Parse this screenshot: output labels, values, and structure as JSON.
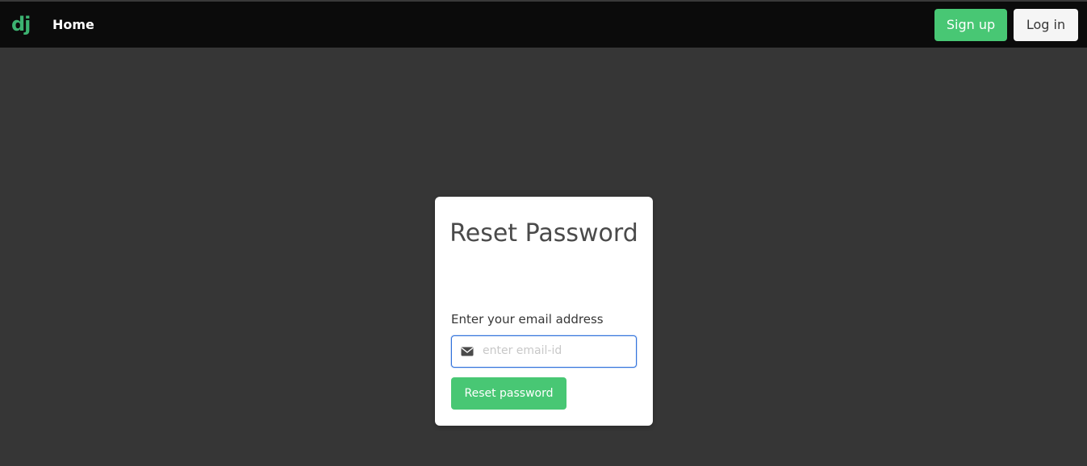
{
  "navbar": {
    "brand": "dj",
    "home_label": "Home",
    "signup_label": "Sign up",
    "login_label": "Log in"
  },
  "reset_card": {
    "title": "Reset Password",
    "email_label": "Enter your email address",
    "email_placeholder": "enter email-id",
    "email_value": "",
    "email_icon": "envelope-icon",
    "submit_label": "Reset password"
  },
  "colors": {
    "page_background": "#363636",
    "navbar_background": "#0b0b0b",
    "accent_green": "#48c774",
    "brand_green": "#3cb371",
    "focus_blue": "#3273dc"
  }
}
